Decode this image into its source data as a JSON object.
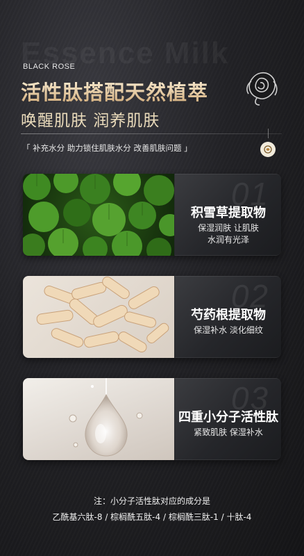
{
  "watermark": "Essence Milk",
  "brand": "BLACK ROSE",
  "headline": "活性肽搭配天然植萃",
  "subheadline": "唤醒肌肤 润养肌肤",
  "tagline": "「 补充水分 助力锁住肌肤水分 改善肌肤问题 」",
  "ingredients": [
    {
      "number": "01",
      "title": "积雪草提取物",
      "desc_line1": "保湿润肤 让肌肤",
      "desc_line2": "水润有光泽",
      "image": "centella-leaves"
    },
    {
      "number": "02",
      "title": "芍药根提取物",
      "desc_line1": "保湿补水 淡化细纹",
      "desc_line2": "",
      "image": "peony-root-slices"
    },
    {
      "number": "03",
      "title": "四重小分子活性肽",
      "desc_line1": "紧致肌肤 保湿补水",
      "desc_line2": "",
      "image": "serum-droplet"
    }
  ],
  "note_line1": "注：小分子活性肽对应的成分是",
  "note_line2": "乙酰基六肽-8 / 棕榈酰五肽-4 / 棕榈酰三肽-1 / 十肽-4",
  "colors": {
    "gold": "#e9d2a8",
    "background": "#222226",
    "panel": "#2c2d31"
  }
}
